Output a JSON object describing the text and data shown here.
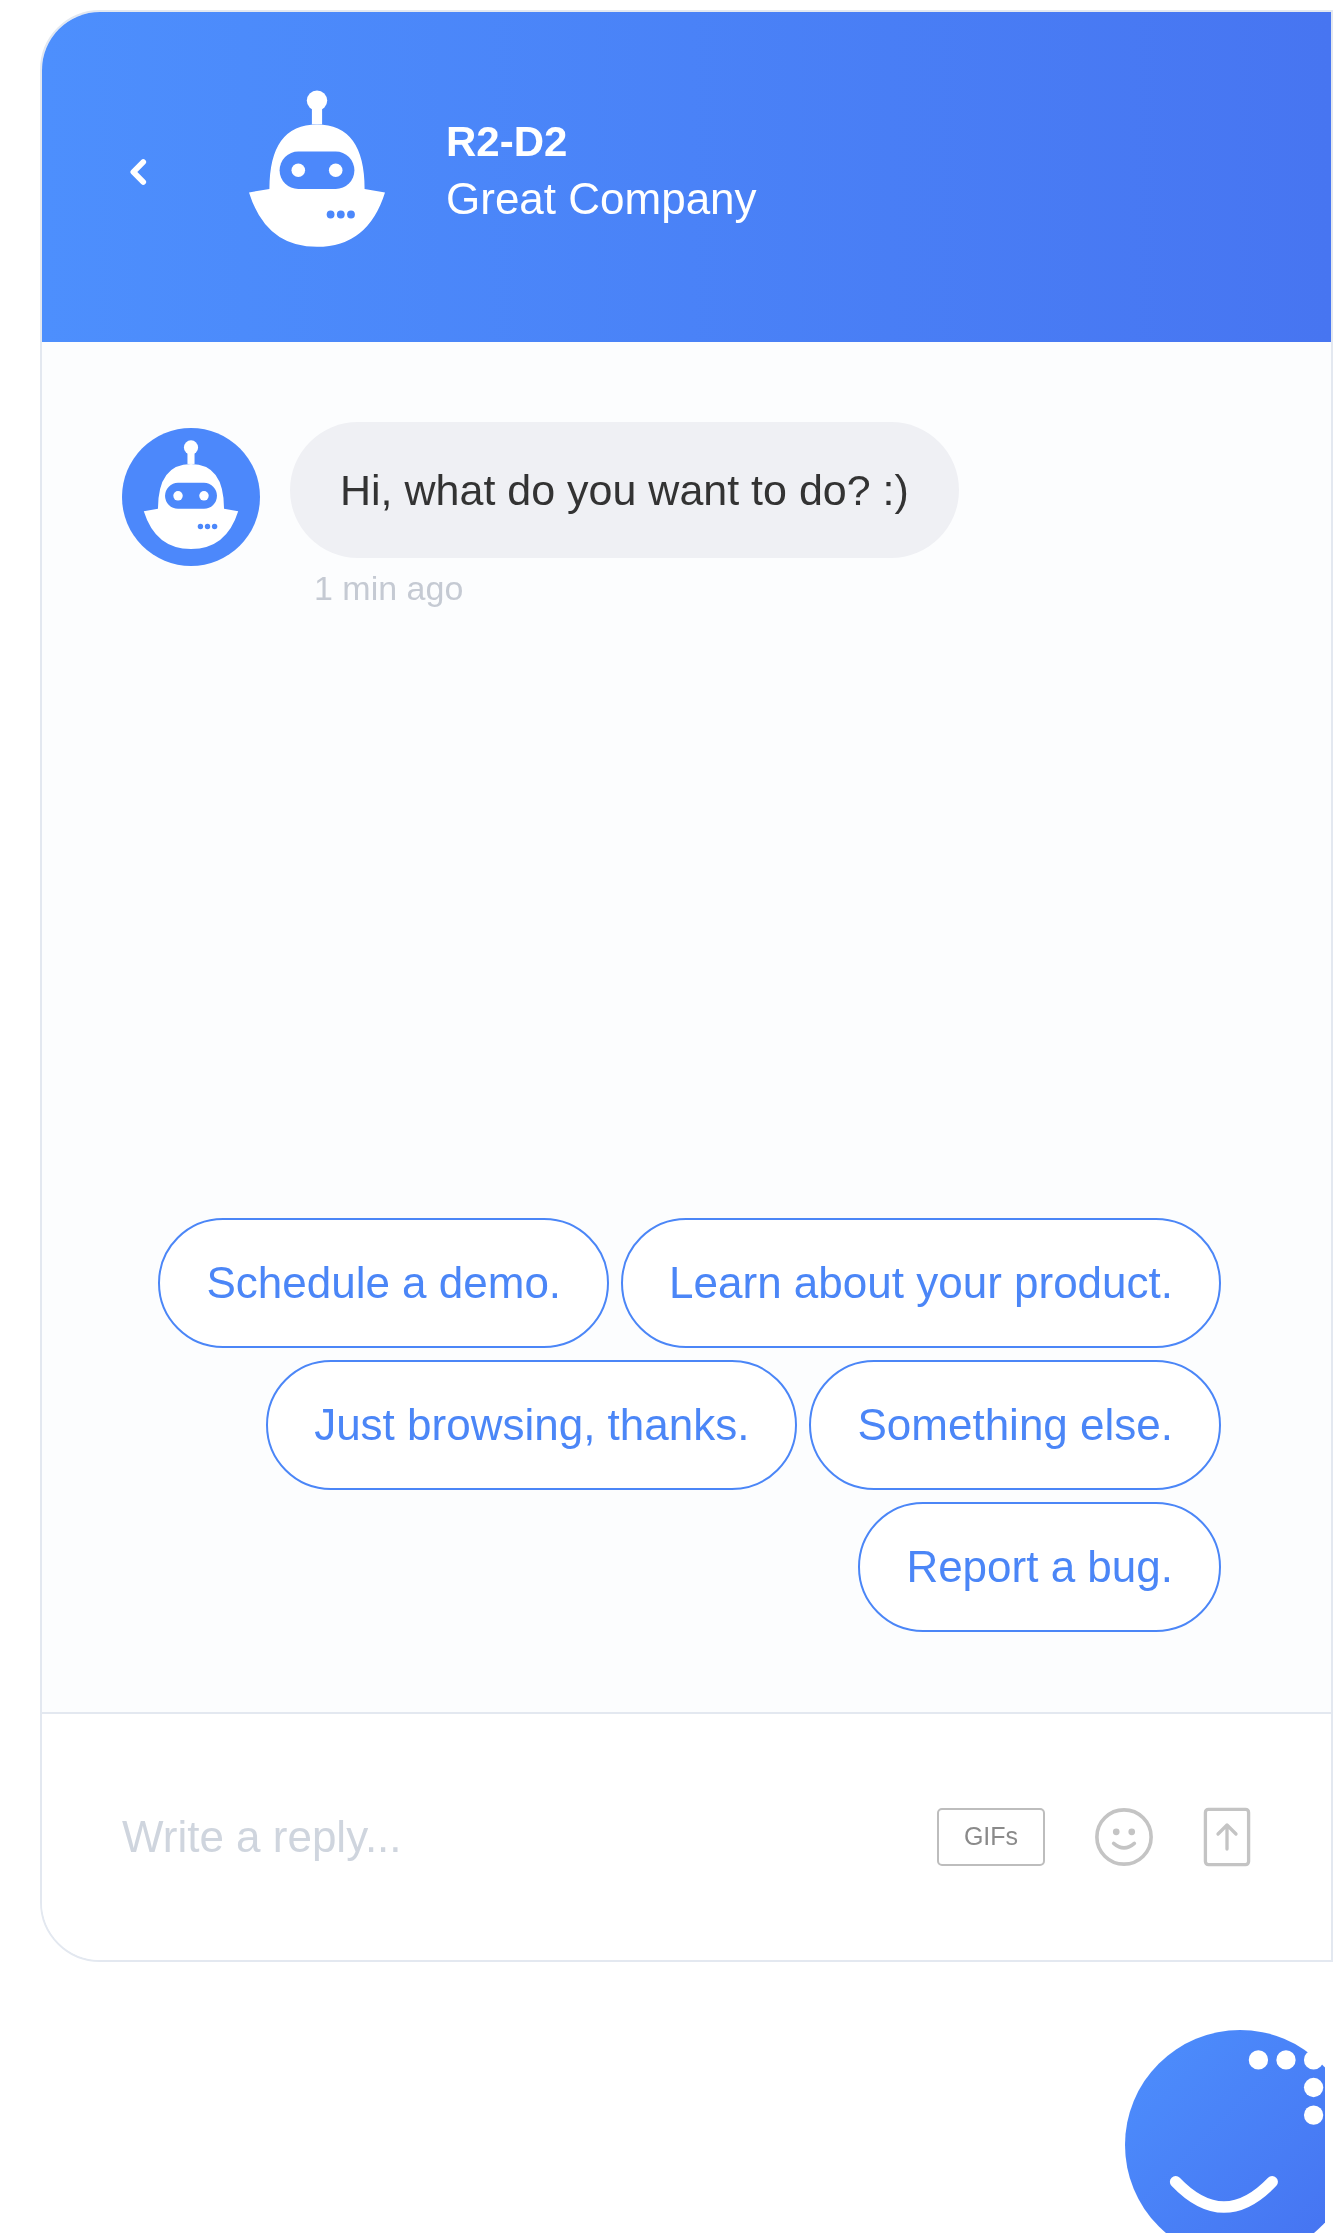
{
  "header": {
    "title": "R2-D2",
    "subtitle": "Great Company"
  },
  "messages": [
    {
      "text": "Hi, what do you want to do? :)",
      "time": "1 min ago"
    }
  ],
  "quick_replies": [
    {
      "label": "Schedule a demo."
    },
    {
      "label": "Learn about your product."
    },
    {
      "label": "Just browsing, thanks."
    },
    {
      "label": "Something else."
    },
    {
      "label": "Report a bug."
    }
  ],
  "composer": {
    "placeholder": "Write a reply...",
    "gif_button": "GIFs"
  }
}
